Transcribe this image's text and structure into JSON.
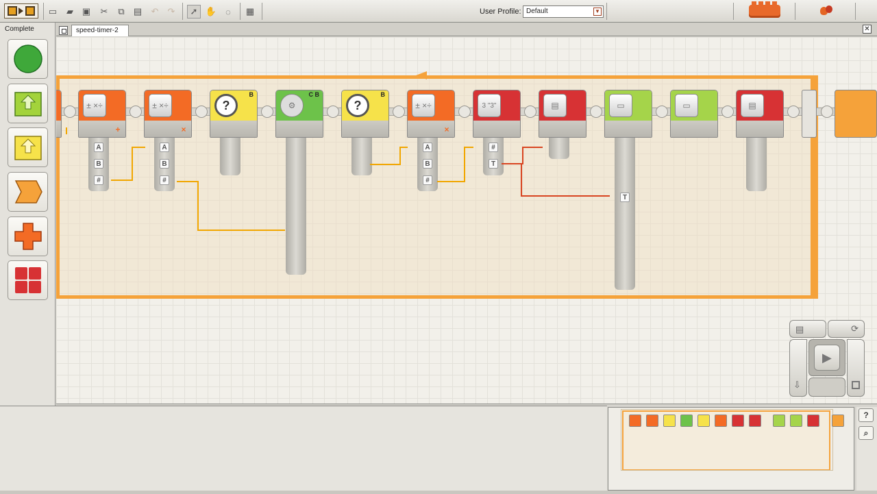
{
  "toolbar": {
    "user_profile_label": "User Profile:",
    "user_profile_value": "Default"
  },
  "palette": {
    "title": "Complete"
  },
  "tabs": [
    {
      "label": "speed-timer-2"
    }
  ],
  "program": {
    "blocks": [
      {
        "type": "math",
        "color": "#f36b25",
        "op_icon": "+"
      },
      {
        "type": "math",
        "color": "#f36b25",
        "op_icon": "×"
      },
      {
        "type": "rotation-sensor",
        "color": "#f6e24a",
        "port": "B"
      },
      {
        "type": "motor",
        "color": "#6dc24a",
        "port": "C B"
      },
      {
        "type": "rotation-sensor",
        "color": "#f6e24a",
        "port": "B"
      },
      {
        "type": "math",
        "color": "#f36b25",
        "op_icon": "×"
      },
      {
        "type": "number-to-text",
        "color": "#d73234",
        "label": "3 \"3\""
      },
      {
        "type": "file-access",
        "color": "#d73234"
      },
      {
        "type": "display",
        "color": "#a5d44a"
      },
      {
        "type": "display",
        "color": "#a5d44a"
      },
      {
        "type": "file-access",
        "color": "#d73234"
      }
    ]
  },
  "colors": {
    "loop": "#f5a23a",
    "wire_number": "#f1a600",
    "wire_text": "#d84420"
  },
  "help": {
    "question_label": "?"
  }
}
